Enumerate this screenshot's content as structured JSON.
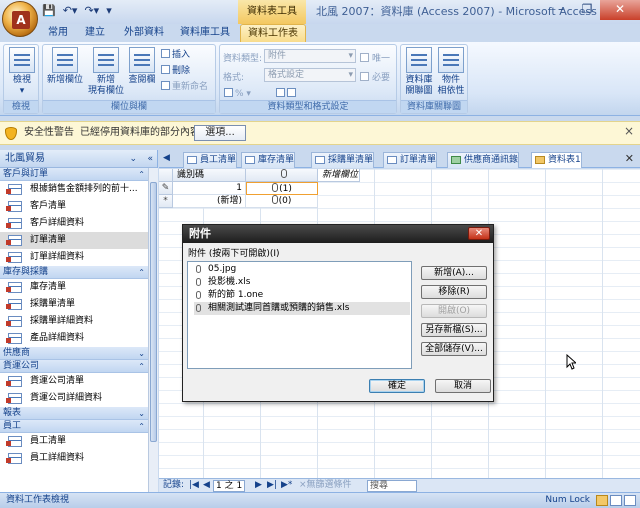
{
  "title_bar": {
    "context_label": "資料表工具",
    "app_title": "北風 2007：資料庫 (Access 2007) - Microsoft Access",
    "minimize": "–",
    "restore": "❐",
    "close": "✕"
  },
  "ribbon_tabs": [
    "常用",
    "建立",
    "外部資料",
    "資料庫工具",
    "資料工作表"
  ],
  "ribbon": {
    "views_group": {
      "view_btn": "檢視",
      "label": "檢視"
    },
    "fields_group": {
      "new_field": "新增欄位",
      "add_existing_line1": "新增",
      "add_existing_line2": "現有欄位",
      "lookup_col": "查閱欄",
      "insert": "插入",
      "delete": "刪除",
      "rename": "重新命名",
      "label": "欄位與欄"
    },
    "datatype_group": {
      "data_type_label": "資料類型:",
      "data_type_value": "附件",
      "format_label": "格式:",
      "format_value": "格式設定",
      "unique": "唯一",
      "required": "必要",
      "percent_btn": "%",
      "label": "資料類型和格式設定"
    },
    "relationships_group": {
      "relationships_line1": "資料庫",
      "relationships_line2": "關聯圖",
      "dependencies_line1": "物件",
      "dependencies_line2": "相依性",
      "label": "資料庫關聯圖"
    }
  },
  "security_bar": {
    "title": "安全性警告",
    "message": "已經停用資料庫的部分內容",
    "options_btn": "選項...",
    "close": "×"
  },
  "nav_pane": {
    "header": "北風貿易",
    "groups": [
      {
        "label": "客戶與訂單",
        "items": [
          "根據銷售金額排列的前十...",
          "客戶清單",
          "客戶詳細資料",
          "訂單清單",
          "訂單詳細資料"
        ]
      },
      {
        "label": "庫存與採購",
        "items": [
          "庫存清單",
          "採購單清單",
          "採購單詳細資料",
          "產品詳細資料"
        ]
      },
      {
        "label": "供應商",
        "items": []
      },
      {
        "label": "貨運公司",
        "items": [
          "貨運公司清單",
          "貨運公司詳細資料"
        ]
      },
      {
        "label": "報表",
        "items": []
      },
      {
        "label": "員工",
        "items": [
          "員工清單",
          "員工詳細資料"
        ]
      }
    ],
    "selected_item": "訂單清單"
  },
  "doc_tabs": [
    "員工清單",
    "庫存清單",
    "採購單清單",
    "訂單清單",
    "供應商通訊錄",
    "資料表1"
  ],
  "datasheet": {
    "headers": [
      "識別碼",
      "",
      "新增欄位"
    ],
    "rows": [
      {
        "selector": "✎",
        "id": "1",
        "attachment": "(1)"
      },
      {
        "selector": "*",
        "id": "(新增)",
        "attachment": "(0)"
      }
    ]
  },
  "record_nav": {
    "label": "記錄:",
    "position": "1 之 1",
    "filter": "無篩選條件",
    "search": "搜尋"
  },
  "status_bar": {
    "left": "資料工作表檢視",
    "num_lock": "Num Lock"
  },
  "dialog": {
    "title": "附件",
    "instruction": "附件 (按兩下可開啟)(I)",
    "files": [
      "05.jpg",
      "投影機.xls",
      "新的節 1.one",
      "相關測試連同首購或預購的銷售.xls"
    ],
    "buttons": {
      "add": "新增(A)...",
      "remove": "移除(R)",
      "open": "開啟(O)",
      "save_as": "另存新檔(S)...",
      "save_all": "全部儲存(V)...",
      "ok": "確定",
      "cancel": "取消"
    },
    "close": "✕"
  }
}
